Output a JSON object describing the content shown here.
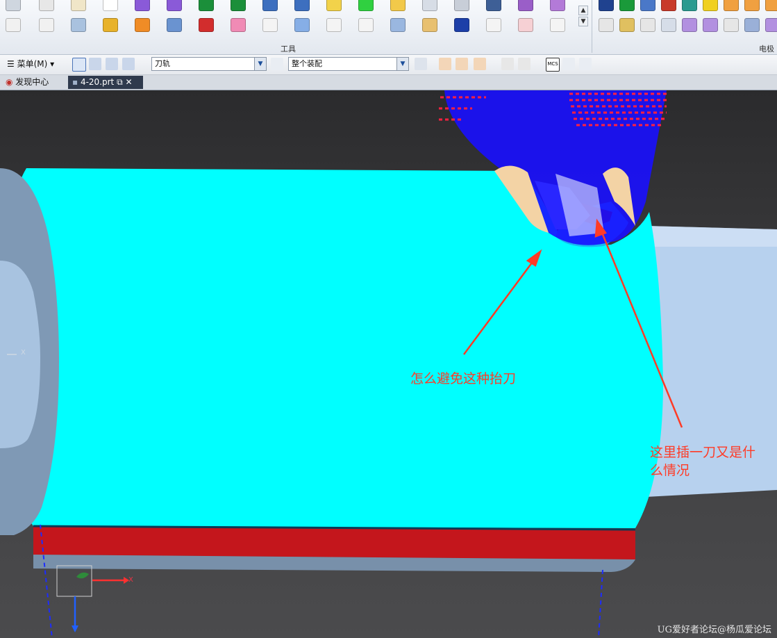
{
  "ribbon": {
    "group_tools_label": "工具",
    "group_electrode_label": "电极",
    "scroll_up": "▲",
    "scroll_down": "▼"
  },
  "toolbar": {
    "menu_label": "菜单(M)",
    "filter_value": "刀轨",
    "assembly_value": "整个装配",
    "dropdown_glyph": "▼",
    "mcs_label": "MCS"
  },
  "tabs": {
    "home": "发现中心",
    "active": "4-20.prt"
  },
  "viewport": {
    "callout_1": "怎么避免这种抬刀",
    "callout_2_line1": "这里插一刀又是什",
    "callout_2_line2": "么情况",
    "axis_x": "X",
    "axis_x_left": "X",
    "watermark": "UG爱好者论坛@杨瓜爱论坛"
  },
  "colors": {
    "part_cyan": "#00ffff",
    "shaft_blue": "#a9c9ea",
    "red_band": "#c4161c",
    "toolpath_blue": "#1a10ff",
    "toolpath_red": "#ff2040",
    "annotation_red": "#ff3b26"
  }
}
